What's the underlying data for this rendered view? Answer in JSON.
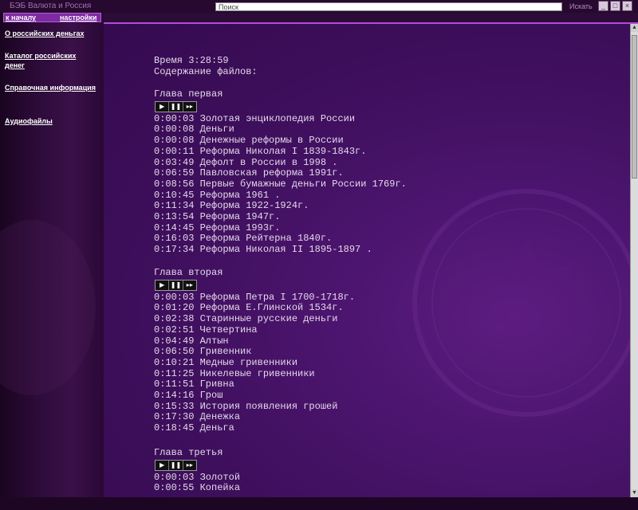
{
  "window": {
    "title": "БЭБ Валюта и Россия",
    "search_value": "Поиск",
    "search_button": "Искать",
    "controls": [
      "_",
      "□",
      "×"
    ]
  },
  "sidebar": {
    "tabs": [
      "к началу",
      "настройки"
    ],
    "links": [
      "О российских деньгах",
      "Каталог российских денег",
      "Справочная информация",
      "Аудиофайлы"
    ]
  },
  "content": {
    "time": "Время 3:28:59",
    "contents_label": "Содержание файлов:",
    "player_buttons": [
      "▶",
      "❚❚",
      "▸▸"
    ],
    "chapters": [
      {
        "title": "Глава первая",
        "tracks": [
          "0:00:03 Золотая энциклопедия России",
          "0:00:08 Деньги",
          "0:00:08 Денежные реформы в России",
          "0:00:11 Реформа Николая I 1839-1843г.",
          "0:03:49 Дефолт в России в 1998 .",
          "0:06:59 Павловская реформа 1991г.",
          "0:08:56 Первые бумажные деньги России 1769г.",
          "0:10:45 Реформа 1961 .",
          "0:11:34 Реформа 1922-1924г.",
          "0:13:54 Реформа 1947г.",
          "0:14:45 Реформа 1993г.",
          "0:16:03 Реформа Рейтерна 1840г.",
          "0:17:34 Реформа Николая II 1895-1897 ."
        ]
      },
      {
        "title": "Глава вторая",
        "tracks": [
          "0:00:03 Реформа Петра I 1700-1718г.",
          "0:01:20 Реформа Е.Глинской 1534г.",
          "0:02:38 Старинные русские деньги",
          "0:02:51 Четвертина",
          "0:04:49 Алтын",
          "0:06:50 Гривенник",
          "0:10:21 Медные гривенники",
          "0:11:25 Никелевые гривенники",
          "0:11:51 Гривна",
          "0:14:16 Грош",
          "0:15:33 История появления грошей",
          "0:17:30 Денежка",
          "0:18:45 Деньга"
        ]
      },
      {
        "title": "Глава третья",
        "tracks": [
          "0:00:03 Золотой",
          "0:00:55 Копейка"
        ]
      }
    ]
  },
  "colors": {
    "accent": "#b04cd8",
    "tab_bg": "#7e2aa3",
    "background": "#3e0f5c",
    "text": "#e4d8ea"
  }
}
